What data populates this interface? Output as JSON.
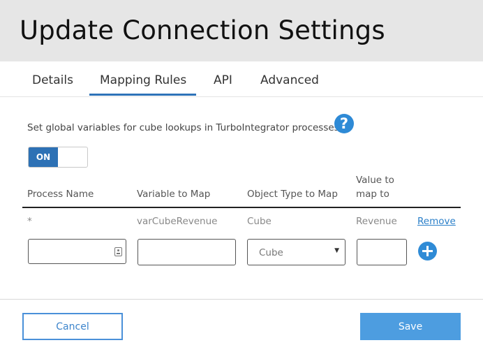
{
  "header": {
    "title": "Update Connection Settings"
  },
  "tabs": [
    {
      "label": "Details"
    },
    {
      "label": "Mapping Rules",
      "active": true
    },
    {
      "label": "API"
    },
    {
      "label": "Advanced"
    }
  ],
  "description": "Set global variables for cube lookups in TurboIntegrator processes.",
  "help_icon": {
    "symbol": "?",
    "icon": "question-circle-icon"
  },
  "toggle": {
    "label": "ON",
    "state": "on"
  },
  "table": {
    "columns": [
      "Process Name",
      "Variable to Map",
      "Object Type to Map",
      "Value to",
      "map to"
    ],
    "rows": [
      {
        "process_name": "*",
        "variable": "varCubeRevenue",
        "object_type": "Cube",
        "value": "Revenue",
        "action": "Remove"
      }
    ],
    "new_row": {
      "process_name": "",
      "variable": "",
      "object_type_selected": "Cube",
      "value": ""
    }
  },
  "footer": {
    "cancel_label": "Cancel",
    "save_label": "Save"
  },
  "colors": {
    "accent": "#2e73b8",
    "button": "#4d9de0",
    "header_bg": "#e6e6e6"
  }
}
